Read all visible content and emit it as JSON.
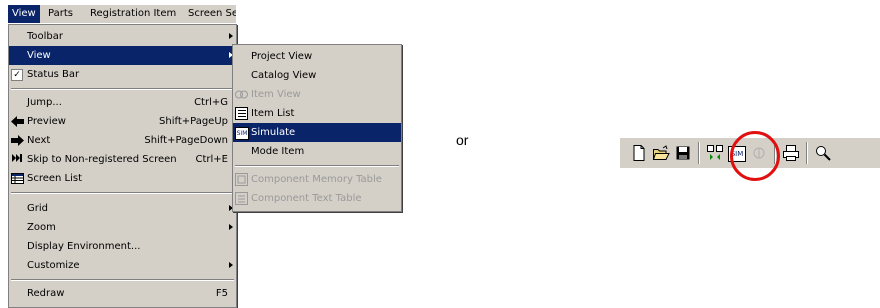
{
  "menubar": {
    "items": [
      "View",
      "Parts",
      "Registration Item",
      "Screen Se"
    ]
  },
  "view_menu": {
    "items": [
      {
        "label": "Toolbar",
        "submenu": true
      },
      {
        "label": "View",
        "submenu": true,
        "highlighted": true
      },
      {
        "label": "Status Bar",
        "checked": true
      },
      {
        "label": "Jump...",
        "shortcut": "Ctrl+G"
      },
      {
        "label": "Preview",
        "shortcut": "Shift+PageUp",
        "icon": "arrow-left-icon"
      },
      {
        "label": "Next",
        "shortcut": "Shift+PageDown",
        "icon": "arrow-right-icon"
      },
      {
        "label": "Skip to Non-registered Screen",
        "shortcut": "Ctrl+E",
        "icon": "skip-icon"
      },
      {
        "label": "Screen List",
        "icon": "screen-list-icon"
      },
      {
        "label": "Grid",
        "submenu": true
      },
      {
        "label": "Zoom",
        "submenu": true
      },
      {
        "label": "Display Environment..."
      },
      {
        "label": "Customize",
        "submenu": true
      },
      {
        "label": "Redraw",
        "shortcut": "F5"
      }
    ]
  },
  "view_submenu": {
    "items": [
      {
        "label": "Project View"
      },
      {
        "label": "Catalog View"
      },
      {
        "label": "Item View",
        "disabled": true,
        "icon": "item-view-icon"
      },
      {
        "label": "Item List",
        "icon": "item-list-icon"
      },
      {
        "label": "Simulate",
        "highlighted": true,
        "icon": "simulate-icon"
      },
      {
        "label": "Mode Item"
      },
      {
        "label": "Component Memory Table",
        "disabled": true,
        "icon": "component-memory-icon"
      },
      {
        "label": "Component Text Table",
        "disabled": true,
        "icon": "component-text-icon"
      }
    ]
  },
  "or_text": "or",
  "toolbar": {
    "icons": [
      "new-file-icon",
      "open-folder-icon",
      "save-icon",
      "transfer-icon",
      "simulate-icon",
      "disabled-icon",
      "print-icon",
      "zoom-icon"
    ],
    "sim_label": "SIM"
  },
  "colors": {
    "menu_bg": "#d4d0c8",
    "highlight": "#0a246a",
    "circle": "#e01010"
  }
}
